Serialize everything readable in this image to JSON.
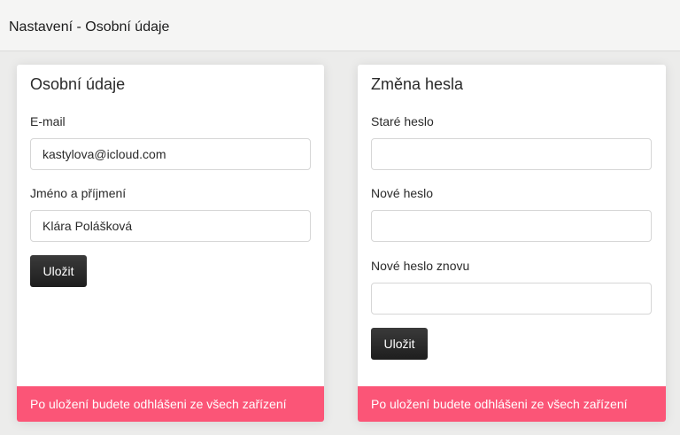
{
  "header": {
    "title": "Nastavení - Osobní údaje"
  },
  "personal": {
    "title": "Osobní údaje",
    "email_label": "E-mail",
    "email_value": "kastylova@icloud.com",
    "name_label": "Jméno a příjmení",
    "name_value": "Klára Polášková",
    "save_label": "Uložit",
    "warning": "Po uložení budete odhlášeni ze všech zařízení"
  },
  "password": {
    "title": "Změna hesla",
    "old_label": "Staré heslo",
    "old_value": "",
    "new_label": "Nové heslo",
    "new_value": "",
    "repeat_label": "Nové heslo znovu",
    "repeat_value": "",
    "save_label": "Uložit",
    "warning": "Po uložení budete odhlášeni ze všech zařízení"
  },
  "colors": {
    "background": "#ececeb",
    "warning": "#fb5577",
    "button": "#222222"
  }
}
